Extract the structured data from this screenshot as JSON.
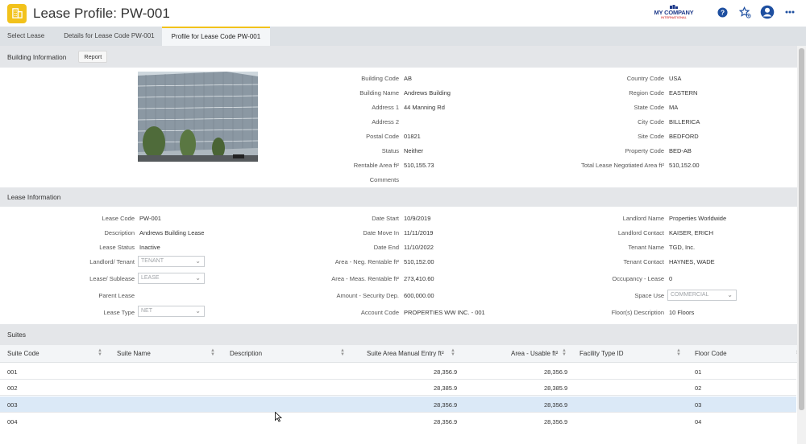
{
  "header": {
    "title": "Lease Profile: PW-001",
    "logo_main": "MY COMPANY",
    "logo_sub": "INTERNATIONAL",
    "icons": [
      "help-icon",
      "favorite-star-icon",
      "user-avatar-icon",
      "more-icon"
    ]
  },
  "tabs": [
    {
      "label": "Select Lease"
    },
    {
      "label": "Details for Lease Code PW-001"
    },
    {
      "label": "Profile for Lease Code PW-001"
    }
  ],
  "building": {
    "section_title": "Building Information",
    "report_label": "Report",
    "col1": [
      {
        "label": "Building Code",
        "value": "AB"
      },
      {
        "label": "Building Name",
        "value": "Andrews Building"
      },
      {
        "label": "Address 1",
        "value": "44 Manning Rd"
      },
      {
        "label": "Address 2",
        "value": ""
      },
      {
        "label": "Postal Code",
        "value": "01821"
      },
      {
        "label": "Status",
        "value": "Neither"
      },
      {
        "label": "Rentable Area ft²",
        "value": "510,155.73"
      },
      {
        "label": "Comments",
        "value": ""
      }
    ],
    "col2": [
      {
        "label": "Country Code",
        "value": "USA"
      },
      {
        "label": "Region Code",
        "value": "EASTERN"
      },
      {
        "label": "State Code",
        "value": "MA"
      },
      {
        "label": "City Code",
        "value": "BILLERICA"
      },
      {
        "label": "Site Code",
        "value": "BEDFORD"
      },
      {
        "label": "Property Code",
        "value": "BED-AB"
      },
      {
        "label": "Total Lease Negotiated Area ft²",
        "value": "510,152.00"
      }
    ]
  },
  "lease": {
    "section_title": "Lease Information",
    "col1": [
      {
        "label": "Lease Code",
        "value": "PW-001"
      },
      {
        "label": "Description",
        "value": "Andrews Building Lease"
      },
      {
        "label": "Lease Status",
        "value": "Inactive"
      },
      {
        "label": "Landlord/ Tenant",
        "value": "TENANT"
      },
      {
        "label": "Lease/ Sublease",
        "value": "LEASE"
      },
      {
        "label": "Parent Lease",
        "value": ""
      },
      {
        "label": "Lease Type",
        "value": "NET"
      }
    ],
    "col2": [
      {
        "label": "Date Start",
        "value": "10/9/2019"
      },
      {
        "label": "Date Move In",
        "value": "11/11/2019"
      },
      {
        "label": "Date End",
        "value": "11/10/2022"
      },
      {
        "label": "Area - Neg. Rentable ft²",
        "value": "510,152.00"
      },
      {
        "label": "Area - Meas. Rentable ft²",
        "value": "273,410.60"
      },
      {
        "label": "Amount - Security Dep.",
        "value": "600,000.00"
      },
      {
        "label": "Account Code",
        "value": "PROPERTIES WW INC. - 001"
      }
    ],
    "col3": [
      {
        "label": "Landlord Name",
        "value": "Properties Worldwide"
      },
      {
        "label": "Landlord Contact",
        "value": "KAISER, ERICH"
      },
      {
        "label": "Tenant Name",
        "value": "TGD, Inc."
      },
      {
        "label": "Tenant Contact",
        "value": "HAYNES, WADE"
      },
      {
        "label": "Occupancy - Lease",
        "value": "0"
      },
      {
        "label": "Space Use",
        "value": "COMMERCIAL"
      },
      {
        "label": "Floor(s) Description",
        "value": "10 Floors"
      }
    ]
  },
  "suites": {
    "section_title": "Suites",
    "columns": [
      "Suite Code",
      "Suite Name",
      "Description",
      "Suite Area Manual Entry ft²",
      "Area - Usable ft²",
      "Facility Type ID",
      "Floor Code"
    ],
    "rows": [
      {
        "code": "001",
        "name": "",
        "desc": "",
        "manual": "28,356.9",
        "usable": "28,356.9",
        "ftype": "",
        "floor": "01"
      },
      {
        "code": "002",
        "name": "",
        "desc": "",
        "manual": "28,385.9",
        "usable": "28,385.9",
        "ftype": "",
        "floor": "02"
      },
      {
        "code": "003",
        "name": "",
        "desc": "",
        "manual": "28,356.9",
        "usable": "28,356.9",
        "ftype": "",
        "floor": "03"
      },
      {
        "code": "004",
        "name": "",
        "desc": "",
        "manual": "28,356.9",
        "usable": "28,356.9",
        "ftype": "",
        "floor": "04"
      }
    ]
  }
}
